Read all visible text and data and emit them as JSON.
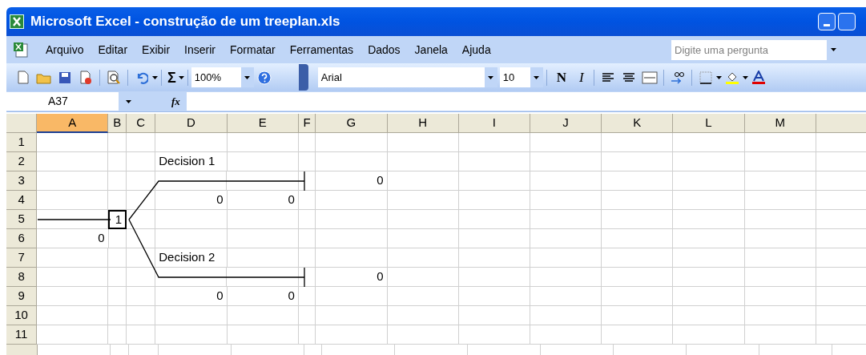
{
  "window": {
    "title": "Microsoft Excel - construção de um treeplan.xls"
  },
  "menu": [
    {
      "label": "Arquivo"
    },
    {
      "label": "Editar"
    },
    {
      "label": "Exibir"
    },
    {
      "label": "Inserir"
    },
    {
      "label": "Formatar"
    },
    {
      "label": "Ferramentas"
    },
    {
      "label": "Dados"
    },
    {
      "label": "Janela"
    },
    {
      "label": "Ajuda"
    }
  ],
  "help_search": {
    "placeholder": "Digite uma pergunta"
  },
  "toolbar": {
    "autosum": "Σ",
    "zoom": "100%",
    "font": "Arial",
    "font_size": "10",
    "bold": "N",
    "italic": "I"
  },
  "formula_bar": {
    "name_box": "A37",
    "fx": "fx"
  },
  "columns": [
    {
      "label": "A",
      "selected": true
    },
    {
      "label": "B",
      "selected": false
    },
    {
      "label": "C",
      "selected": false
    },
    {
      "label": "D",
      "selected": false
    },
    {
      "label": "E",
      "selected": false
    },
    {
      "label": "F",
      "selected": false
    },
    {
      "label": "G",
      "selected": false
    },
    {
      "label": "H",
      "selected": false
    },
    {
      "label": "I",
      "selected": false
    },
    {
      "label": "J",
      "selected": false
    },
    {
      "label": "K",
      "selected": false
    },
    {
      "label": "L",
      "selected": false
    },
    {
      "label": "M",
      "selected": false
    }
  ],
  "rows": [
    {
      "label": "1",
      "cells": [
        null,
        null,
        null,
        null,
        null,
        null,
        null,
        null,
        null,
        null,
        null,
        null,
        null
      ]
    },
    {
      "label": "2",
      "cells": [
        null,
        null,
        null,
        {
          "text": "Decision 1",
          "kind": "label"
        },
        null,
        null,
        null,
        null,
        null,
        null,
        null,
        null,
        null
      ]
    },
    {
      "label": "3",
      "cells": [
        null,
        null,
        null,
        null,
        null,
        null,
        {
          "text": "0",
          "kind": "number"
        },
        null,
        null,
        null,
        null,
        null,
        null
      ]
    },
    {
      "label": "4",
      "cells": [
        null,
        null,
        null,
        {
          "text": "0",
          "kind": "number"
        },
        {
          "text": "0",
          "kind": "number"
        },
        null,
        null,
        null,
        null,
        null,
        null,
        null,
        null
      ]
    },
    {
      "label": "5",
      "cells": [
        null,
        {
          "text": "1",
          "kind": "node"
        },
        null,
        null,
        null,
        null,
        null,
        null,
        null,
        null,
        null,
        null,
        null
      ]
    },
    {
      "label": "6",
      "cells": [
        {
          "text": "0",
          "kind": "number"
        },
        null,
        null,
        null,
        null,
        null,
        null,
        null,
        null,
        null,
        null,
        null,
        null
      ]
    },
    {
      "label": "7",
      "cells": [
        null,
        null,
        null,
        {
          "text": "Decision 2",
          "kind": "label"
        },
        null,
        null,
        null,
        null,
        null,
        null,
        null,
        null,
        null
      ]
    },
    {
      "label": "8",
      "cells": [
        null,
        null,
        null,
        null,
        null,
        null,
        {
          "text": "0",
          "kind": "number"
        },
        null,
        null,
        null,
        null,
        null,
        null
      ]
    },
    {
      "label": "9",
      "cells": [
        null,
        null,
        null,
        {
          "text": "0",
          "kind": "number"
        },
        {
          "text": "0",
          "kind": "number"
        },
        null,
        null,
        null,
        null,
        null,
        null,
        null,
        null
      ]
    },
    {
      "label": "10",
      "cells": [
        null,
        null,
        null,
        null,
        null,
        null,
        null,
        null,
        null,
        null,
        null,
        null,
        null
      ]
    },
    {
      "label": "11",
      "cells": [
        null,
        null,
        null,
        null,
        null,
        null,
        null,
        null,
        null,
        null,
        null,
        null,
        null
      ]
    }
  ]
}
